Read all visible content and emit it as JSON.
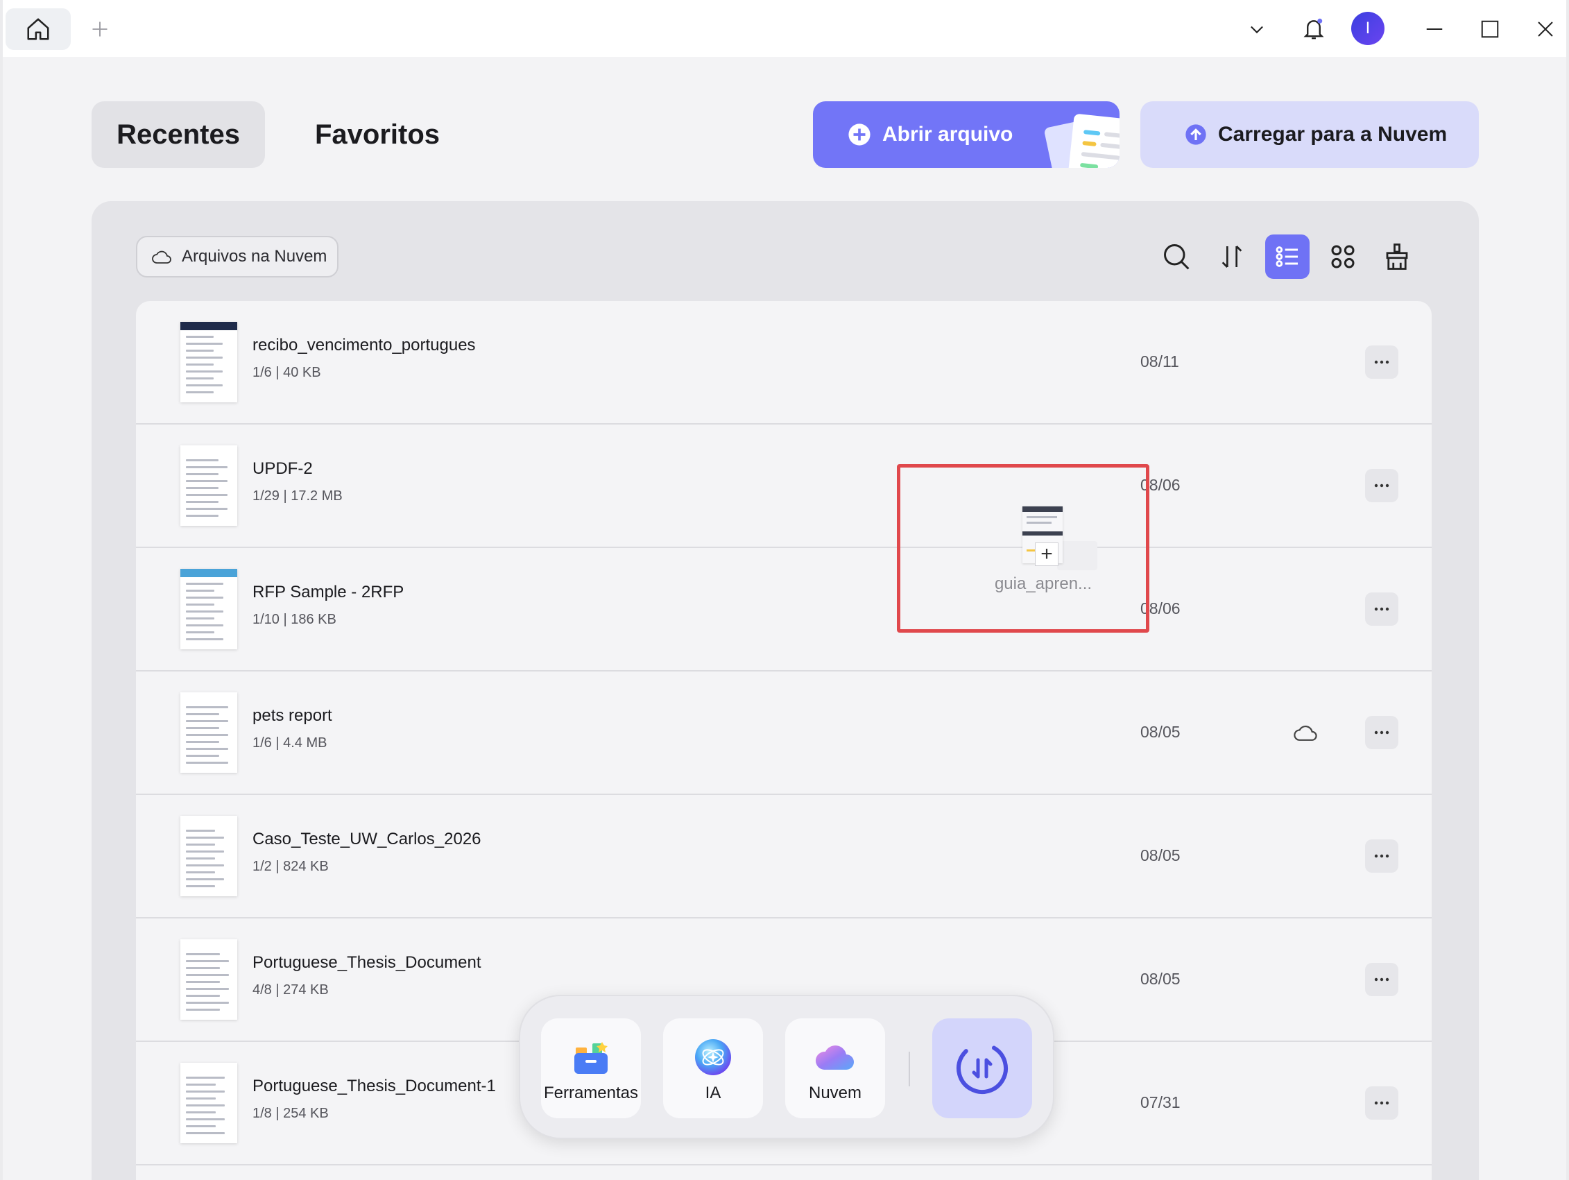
{
  "tabs": {
    "recent": "Recentes",
    "favorites": "Favoritos"
  },
  "actions": {
    "open_file": "Abrir arquivo",
    "upload_cloud": "Carregar para a Nuvem"
  },
  "filter": {
    "cloud_files": "Arquivos na Nuvem"
  },
  "toolbar_icons": [
    "search-icon",
    "sort-icon",
    "list-view-icon",
    "grid-view-icon",
    "clean-icon"
  ],
  "avatar_initial": "I",
  "files": [
    {
      "name": "recibo_vencimento_portugues",
      "meta": "1/6 | 40 KB",
      "date": "08/11",
      "cloud": false,
      "thumb_color": "#1e2a4a"
    },
    {
      "name": "UPDF-2",
      "meta": "1/29 | 17.2 MB",
      "date": "08/06",
      "cloud": false,
      "thumb_color": "#ffffff"
    },
    {
      "name": "RFP Sample - 2RFP",
      "meta": "1/10 | 186 KB",
      "date": "08/06",
      "cloud": false,
      "thumb_color": "#4aa3d8"
    },
    {
      "name": "pets report",
      "meta": "1/6 | 4.4 MB",
      "date": "08/05",
      "cloud": true,
      "thumb_color": "#ffffff"
    },
    {
      "name": "Caso_Teste_UW_Carlos_2026",
      "meta": "1/2 | 824 KB",
      "date": "08/05",
      "cloud": false,
      "thumb_color": "#ffffff"
    },
    {
      "name": "Portuguese_Thesis_Document",
      "meta": "4/8 | 274 KB",
      "date": "08/05",
      "cloud": false,
      "thumb_color": "#ffffff"
    },
    {
      "name": "Portuguese_Thesis_Document-1",
      "meta": "1/8 | 254 KB",
      "date": "07/31",
      "cloud": false,
      "thumb_color": "#ffffff"
    }
  ],
  "drag": {
    "file_name": "guia_apren..."
  },
  "dock": {
    "tools": "Ferramentas",
    "ai": "IA",
    "cloud": "Nuvem"
  },
  "colors": {
    "accent": "#7275f7",
    "accent_light": "#d9dbfa",
    "drag_highlight": "#e0484c"
  }
}
